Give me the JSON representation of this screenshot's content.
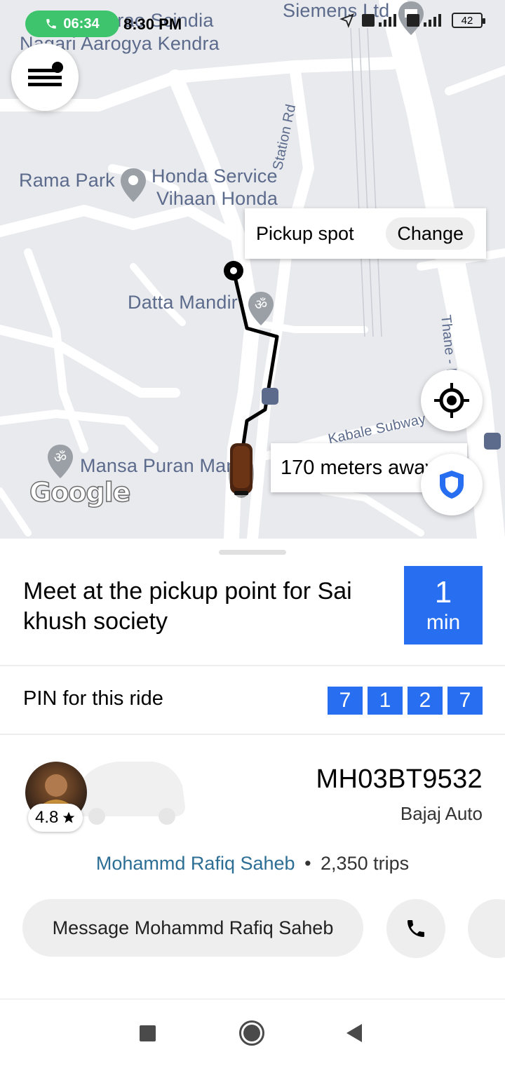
{
  "status_bar": {
    "call_timer": "06:34",
    "clock": "8:30 PM",
    "battery": "42"
  },
  "map": {
    "labels": {
      "top_hospital_line1": "Madhavrao Scindia",
      "top_hospital_line2": "Nagari Aarogya Kendra",
      "siemens": "Siemens Ltd",
      "rama_park": "Rama Park",
      "honda_line1": "Honda Service",
      "honda_line2": "Vihaan Honda",
      "station_rd": "Station Rd",
      "datta_mandir": "Datta Mandir",
      "thane": "Thane - B",
      "kabale_subway": "Kabale Subway",
      "mansa_puran": "Mansa Puran Man"
    },
    "pickup_callout": {
      "label": "Pickup spot",
      "change_label": "Change"
    },
    "distance_text": "170 meters away",
    "google_logo": "Google",
    "menu_icon": "hamburger-menu-icon",
    "locate_icon": "crosshair-icon",
    "safety_icon": "shield-icon"
  },
  "sheet": {
    "meet_text": "Meet at the pickup point for Sai khush society",
    "eta_value": "1",
    "eta_unit": "min",
    "pin_label": "PIN for this ride",
    "pin_digits": [
      "7",
      "1",
      "2",
      "7"
    ],
    "rating": "4.8",
    "plate": "MH03BT9532",
    "vehicle": "Bajaj Auto",
    "driver_name": "Mohammd Rafiq Saheb",
    "separator": "•",
    "trips": "2,350 trips",
    "message_label": "Message Mohammd Rafiq Saheb",
    "accent_color": "#276ef1"
  }
}
